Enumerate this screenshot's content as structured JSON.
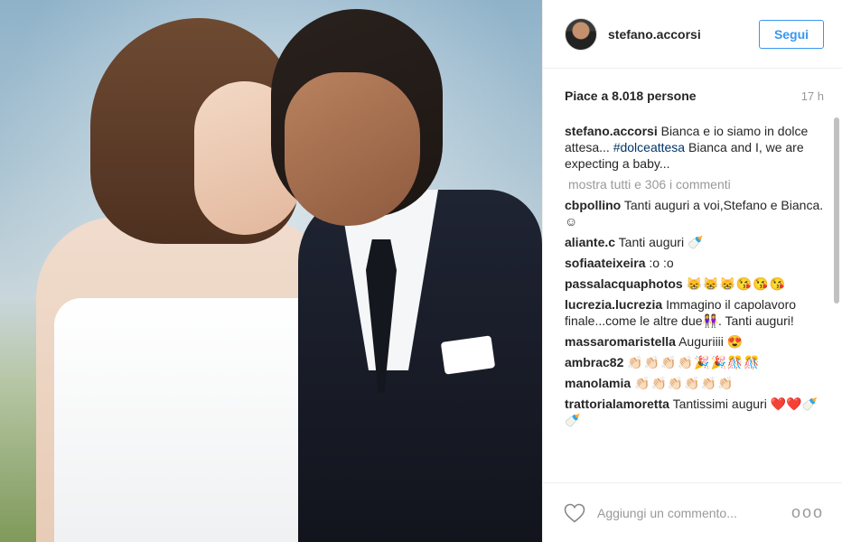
{
  "header": {
    "username": "stefano.accorsi",
    "follow_label": "Segui"
  },
  "meta": {
    "likes": "Piace a 8.018 persone",
    "time": "17 h"
  },
  "caption": {
    "user": "stefano.accorsi",
    "text_before": "Bianca e io siamo in dolce attesa... ",
    "hashtag": "#dolceattesa",
    "text_after": " Bianca and I, we are expecting a baby..."
  },
  "more_comments": "mostra tutti e 306 i commenti",
  "comments": [
    {
      "user": "cbpollino",
      "text": "Tanti auguri a voi,Stefano e Bianca. ☺"
    },
    {
      "user": "aliante.c",
      "text": "Tanti auguri 🍼"
    },
    {
      "user": "sofiaateixeira",
      "text": ":o :o"
    },
    {
      "user": "passalacquaphotos",
      "text": "😸😸😸😘😘😘"
    },
    {
      "user": "lucrezia.lucrezia",
      "text": "Immagino il capolavoro finale...come le altre due👭. Tanti auguri!"
    },
    {
      "user": "massaromaristella",
      "text": "Auguriiii 😍"
    },
    {
      "user": "ambrac82",
      "text": "👏🏻👏🏻👏🏻👏🏻🎉🎉🎊🎊"
    },
    {
      "user": "manolamia",
      "text": "👏🏻👏🏻👏🏻👏🏻👏🏻👏🏻"
    },
    {
      "user": "trattorialamoretta",
      "text": "Tantissimi auguri ❤️❤️🍼🍼"
    }
  ],
  "footer": {
    "add_comment_placeholder": "Aggiungi un commento...",
    "more_dots": "ooo"
  },
  "icons": {
    "like": "heart-icon",
    "options": "more-options-icon"
  }
}
